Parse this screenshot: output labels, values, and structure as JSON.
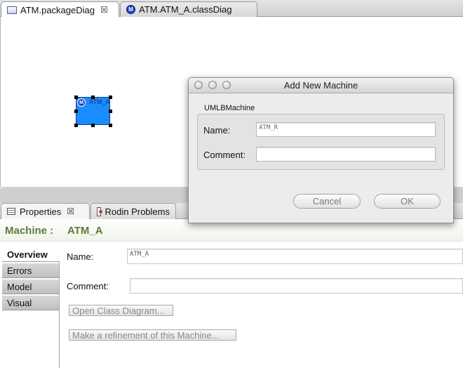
{
  "editor_tabs": [
    {
      "label": "ATM.packageDiag",
      "icon": "package-diagram-icon",
      "active": true
    },
    {
      "label": "ATM.ATM_A.classDiag",
      "icon": "machine-icon",
      "active": false
    }
  ],
  "diagram": {
    "machine_name": "ATM_A",
    "icon_letter": "M",
    "fill_color": "#1a8cff"
  },
  "view_tabs": [
    {
      "label": "Properties",
      "icon": "properties-icon",
      "active": true
    },
    {
      "label": "Rodin Problems",
      "icon": "rodin-problems-icon",
      "active": false
    }
  ],
  "properties": {
    "title": "Machine :",
    "title_value": "ATM_A",
    "side_tabs": [
      "Overview",
      "Errors",
      "Model",
      "Visual"
    ],
    "selected_tab": "Overview",
    "name_label": "Name:",
    "name_value": "ATM_A",
    "comment_label": "Comment:",
    "comment_value": "",
    "open_class_diagram": "Open Class Diagram...",
    "make_refinement": "Make a refinement of this Machine..."
  },
  "dialog": {
    "title": "Add New Machine",
    "group_label": "UMLBMachine",
    "name_label": "Name:",
    "name_value": "ATM_R",
    "comment_label": "Comment:",
    "comment_value": "",
    "cancel": "Cancel",
    "ok": "OK"
  },
  "colors": {
    "section_title": "#5c7c38",
    "machine_blue": "#1a8cff"
  }
}
